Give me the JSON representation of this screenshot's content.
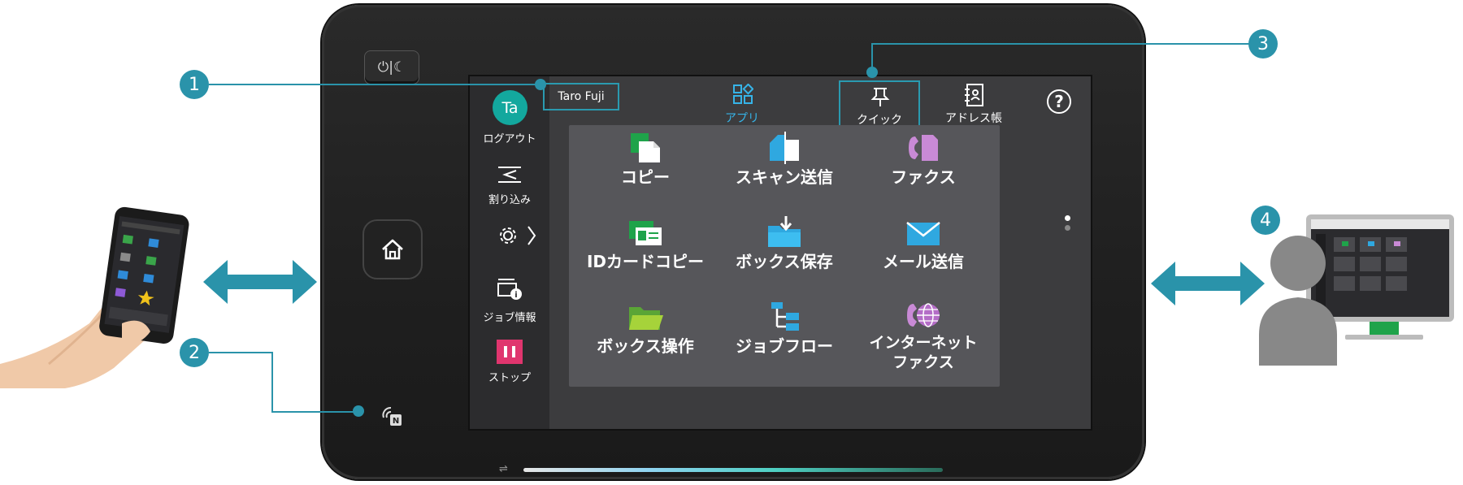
{
  "device": {
    "user_initials": "Ta",
    "user_name": "Taro  Fuji",
    "sidebar": {
      "logout": "ログアウト",
      "interrupt": "割り込み",
      "job_info": "ジョブ情報",
      "stop": "ストップ"
    },
    "nav": {
      "apps": "アプリ",
      "quick": "クイック",
      "address_book": "アドレス帳"
    },
    "tiles": [
      {
        "label": "コピー"
      },
      {
        "label": "スキャン送信"
      },
      {
        "label": "ファクス"
      },
      {
        "label": "IDカードコピー"
      },
      {
        "label": "ボックス保存"
      },
      {
        "label": "メール送信"
      },
      {
        "label": "ボックス操作"
      },
      {
        "label": "ジョブフロー"
      },
      {
        "label": "インターネット\nファクス",
        "line1": "インターネット",
        "line2": "ファクス"
      }
    ],
    "colors": {
      "accent": "#2a93aa",
      "avatar": "#13a89e",
      "apps_active": "#36b4e8",
      "stop": "#e0356e"
    }
  },
  "callouts": [
    "1",
    "2",
    "3",
    "4"
  ],
  "icons": [
    "power-sleep-icon",
    "home-icon",
    "nfc-icon",
    "interrupt-icon",
    "gear-icon",
    "job-info-icon",
    "stop-icon",
    "apps-icon",
    "quick-pin-icon",
    "address-book-icon",
    "help-icon"
  ]
}
